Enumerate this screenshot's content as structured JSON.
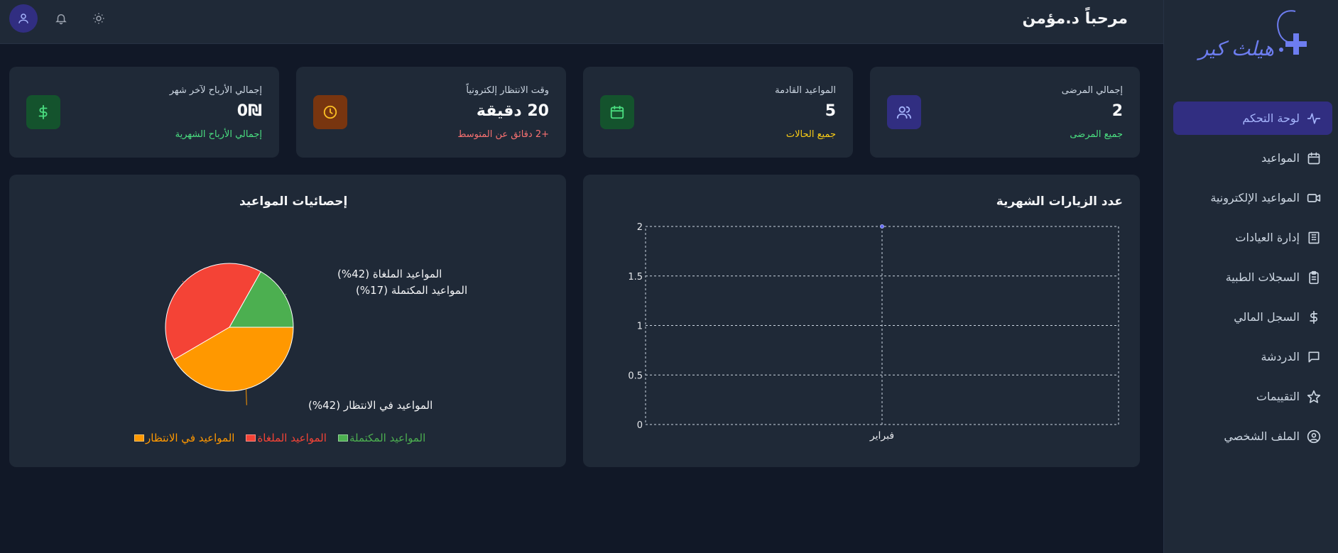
{
  "app": {
    "logo_text": "هيلث كير",
    "welcome": "مرحباً د.مؤمن"
  },
  "sidebar": {
    "items": [
      {
        "label": "لوحة التحكم",
        "icon": "activity-icon",
        "active": true
      },
      {
        "label": "المواعيد",
        "icon": "calendar-icon",
        "active": false
      },
      {
        "label": "المواعيد الإلكترونية",
        "icon": "video-icon",
        "active": false
      },
      {
        "label": "إدارة العيادات",
        "icon": "building-icon",
        "active": false
      },
      {
        "label": "السجلات الطبية",
        "icon": "clipboard-icon",
        "active": false
      },
      {
        "label": "السجل المالي",
        "icon": "dollar-icon",
        "active": false
      },
      {
        "label": "الدردشة",
        "icon": "chat-icon",
        "active": false
      },
      {
        "label": "التقييمات",
        "icon": "star-icon",
        "active": false
      },
      {
        "label": "الملف الشخصي",
        "icon": "user-circle-icon",
        "active": false
      }
    ]
  },
  "stats": [
    {
      "label": "إجمالي المرضى",
      "value": "2",
      "sub": "جميع المرضى",
      "sub_color": "#4ade80",
      "icon": "users-icon",
      "icon_bg": "#312e81",
      "icon_color": "#a5b4fc"
    },
    {
      "label": "المواعيد القادمة",
      "value": "5",
      "sub": "جميع الحالات",
      "sub_color": "#facc15",
      "icon": "calendar-icon",
      "icon_bg": "#14532d",
      "icon_color": "#4ade80"
    },
    {
      "label": "وقت الانتظار إلكترونياً",
      "value": "20 دقيقة",
      "sub": "+2 دقائق عن المتوسط",
      "sub_color": "#f87171",
      "icon": "clock-icon",
      "icon_bg": "#78350f",
      "icon_color": "#fbbf24"
    },
    {
      "label": "إجمالي الأرباح لآخر شهر",
      "value": "0₪",
      "sub": "إجمالي الأرباح الشهرية",
      "sub_color": "#4ade80",
      "icon": "dollar-icon",
      "icon_bg": "#14532d",
      "icon_color": "#4ade80"
    }
  ],
  "visits_panel": {
    "title": "عدد الزيارات الشهرية"
  },
  "appointments_panel": {
    "title": "إحصائيات المواعيد"
  },
  "chart_data": [
    {
      "type": "line",
      "title": "عدد الزيارات الشهرية",
      "categories": [
        "فبراير"
      ],
      "series": [
        {
          "values": [
            2
          ]
        }
      ],
      "ylim": [
        0,
        2
      ],
      "yticks": [
        "0",
        "0.5",
        "1",
        "1.5",
        "2"
      ],
      "grid": true,
      "point_color": "#6366f1"
    },
    {
      "type": "pie",
      "title": "إحصائيات المواعيد",
      "labels": [
        "المواعيد المكتملة",
        "المواعيد الملغاة",
        "المواعيد في الانتظار"
      ],
      "values": [
        17,
        42,
        42
      ],
      "percent_labels": [
        "المواعيد المكتملة (17%)",
        "المواعيد الملغاة (42%)",
        "المواعيد في الانتظار (42%)"
      ],
      "colors": [
        "#4caf50",
        "#f44336",
        "#ff9800"
      ],
      "legend_position": "bottom"
    }
  ]
}
